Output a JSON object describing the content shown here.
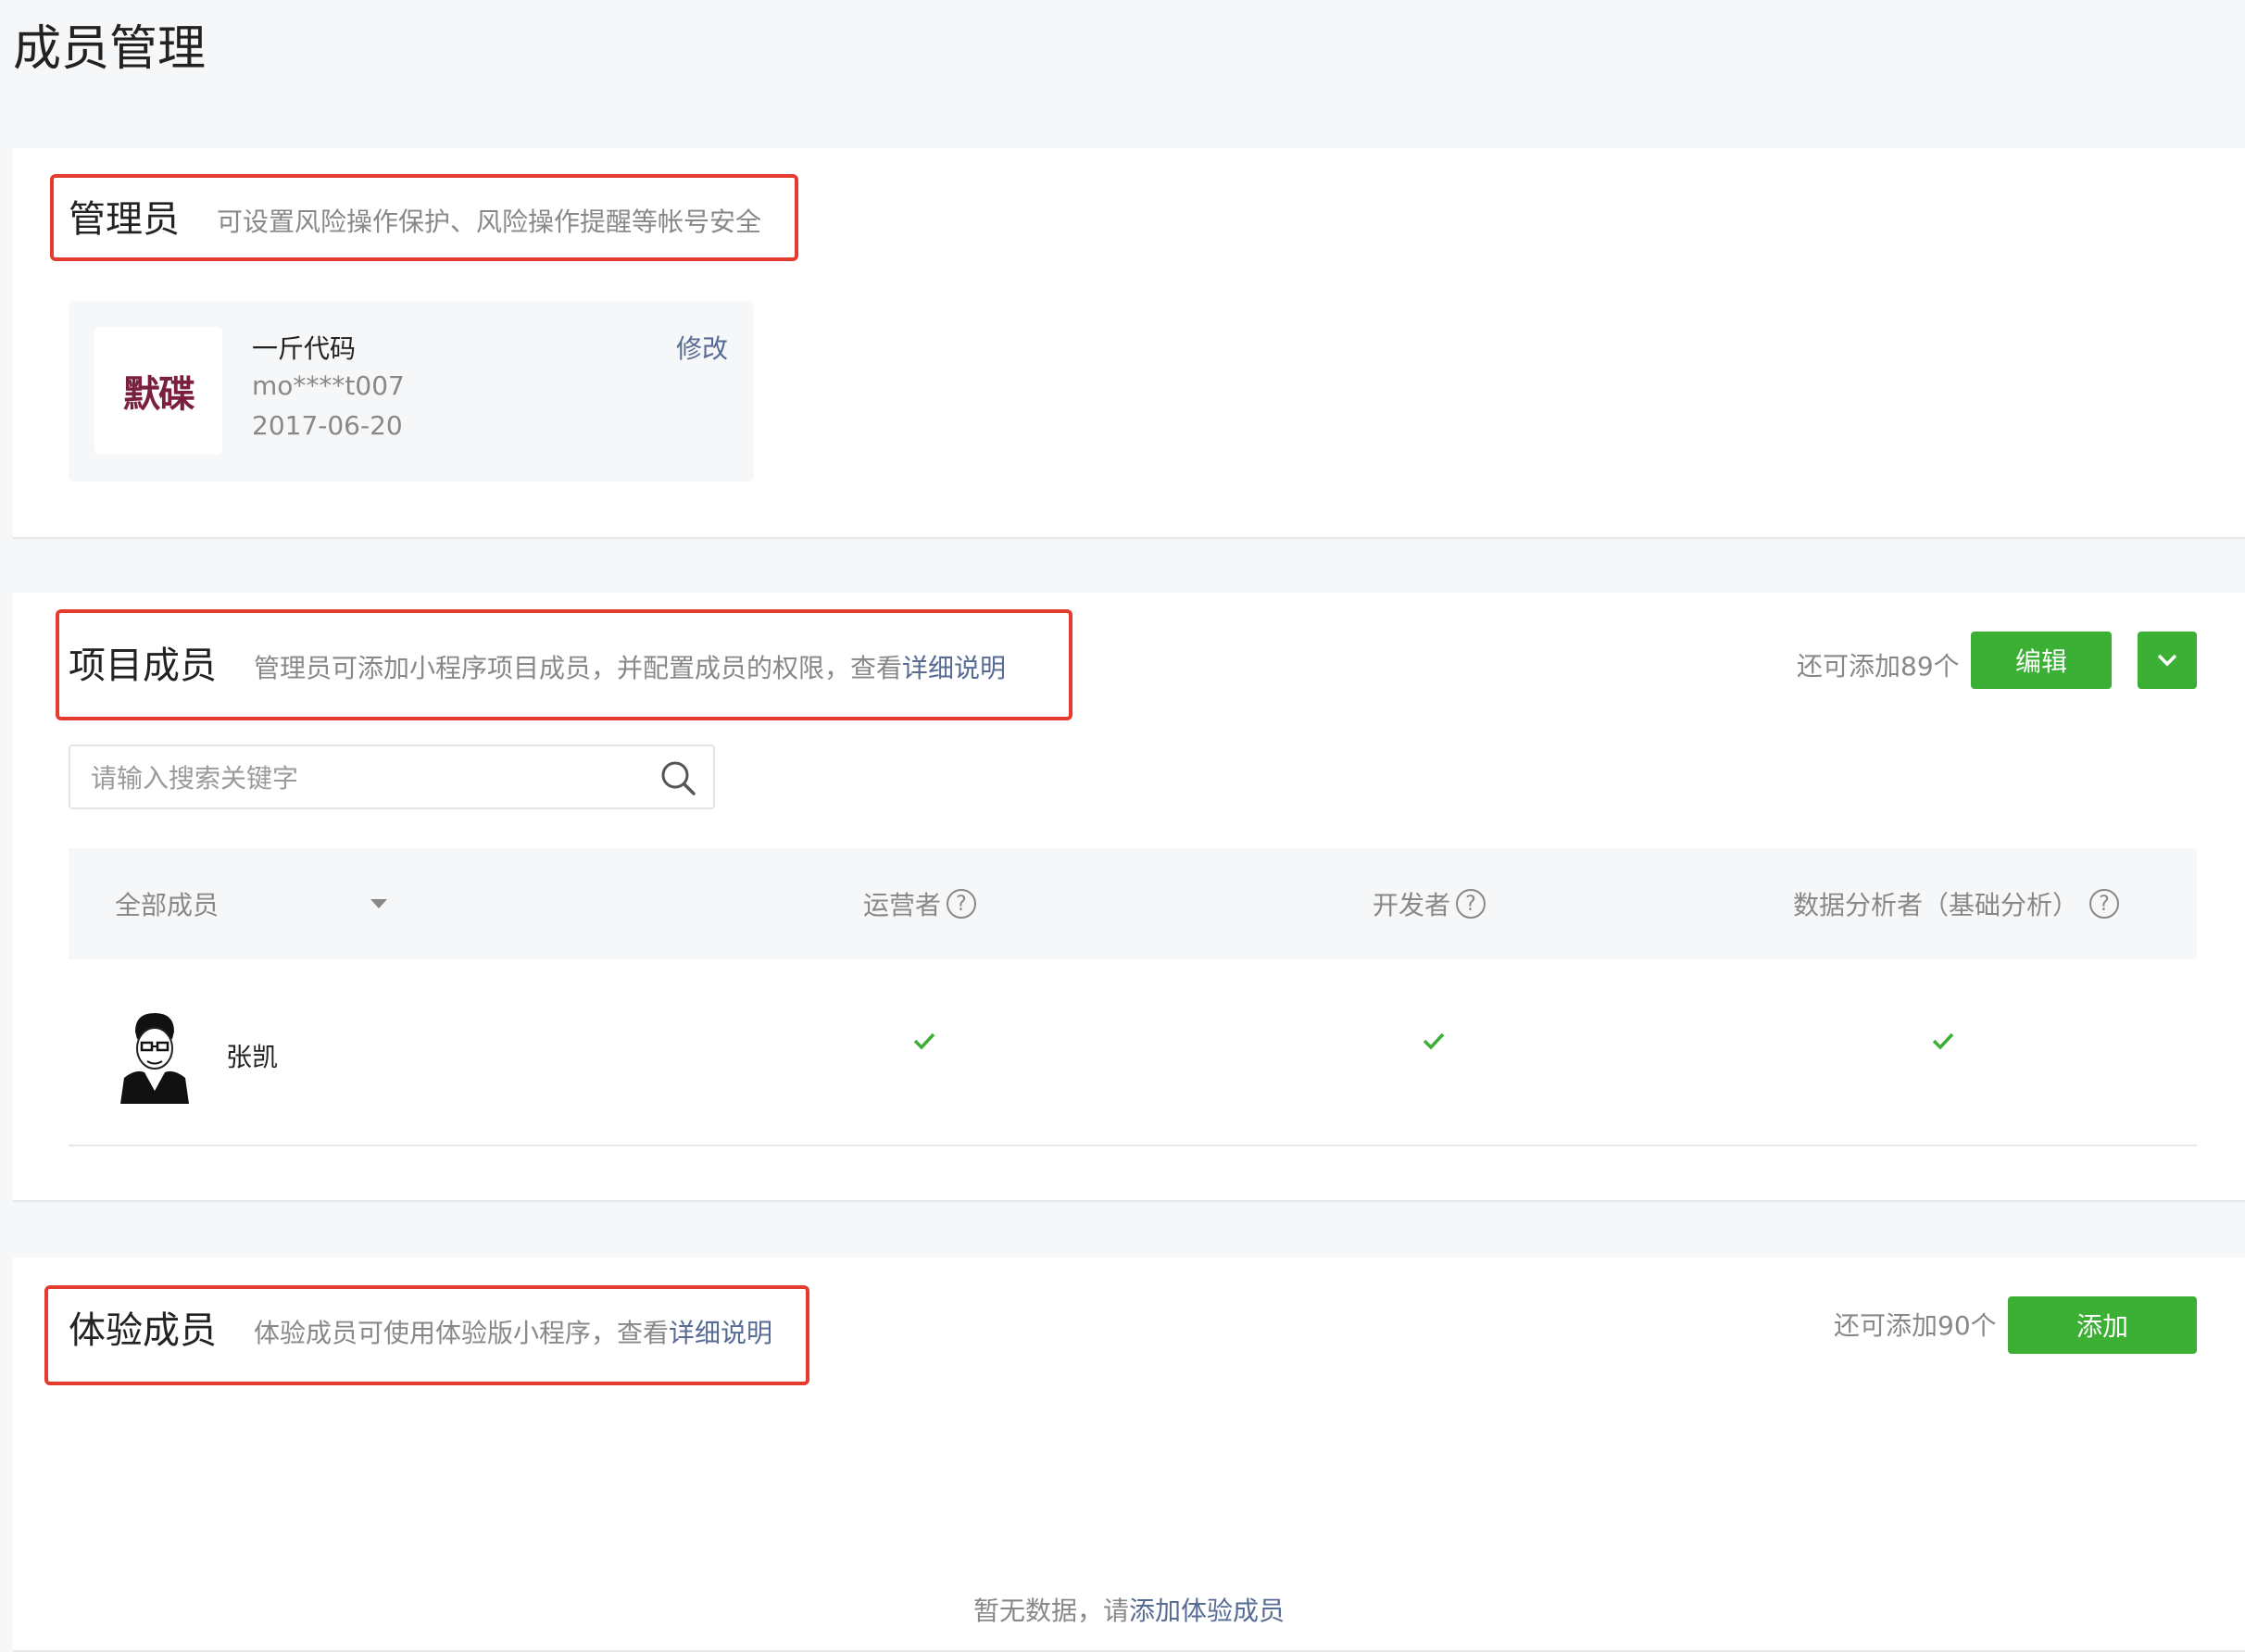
{
  "page": {
    "title": "成员管理"
  },
  "admin": {
    "title": "管理员",
    "desc": "可设置风险操作保护、风险操作提醒等帐号安全",
    "logo_text": "默碟",
    "name": "一斤代码",
    "account": "mo****t007",
    "date": "2017-06-20",
    "edit_label": "修改"
  },
  "project": {
    "title": "项目成员",
    "desc": "管理员可添加小程序项目成员，并配置成员的权限，查看",
    "desc_link": "详细说明",
    "quota": "还可添加89个",
    "edit_button": "编辑",
    "search_placeholder": "请输入搜索关键字",
    "columns": {
      "filter": "全部成员",
      "operator": "运营者",
      "developer": "开发者",
      "analyst": "数据分析者（基础分析）"
    },
    "help_glyph": "?",
    "members": [
      {
        "name": "张凯",
        "operator": true,
        "developer": true,
        "analyst": true
      }
    ]
  },
  "trial": {
    "title": "体验成员",
    "desc": "体验成员可使用体验版小程序，查看",
    "desc_link": "详细说明",
    "quota": "还可添加90个",
    "add_button": "添加",
    "empty_text": "暂无数据，请",
    "empty_link": "添加体验成员"
  },
  "colors": {
    "accent_green": "#3cb035",
    "link": "#576b95",
    "highlight": "#e33b2e"
  },
  "icons": {
    "search": "search-icon",
    "chevron": "chevron-down-icon",
    "check": "check-icon",
    "help": "help-icon"
  }
}
